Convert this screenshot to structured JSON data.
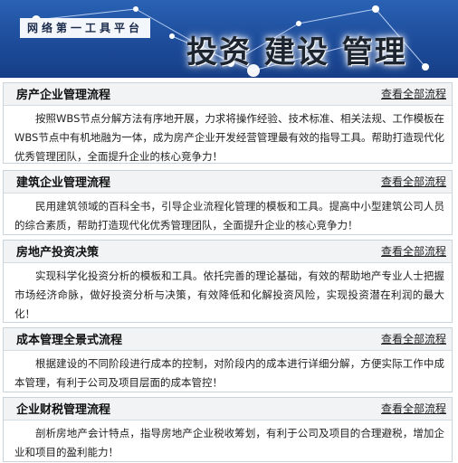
{
  "banner": {
    "tagline": "网络第一工具平台",
    "headline": "投资 建设 管理"
  },
  "sections": [
    {
      "title": "房产企业管理流程",
      "link": "查看全部流程",
      "desc": "按照WBS节点分解方法有序地开展，力求将操作经验、技术标准、相关法规、工作模板在WBS节点中有机地融为一体，成为房产企业开发经营管理最有效的指导工具。帮助打造现代化优秀管理团队，全面提升企业的核心竞争力！"
    },
    {
      "title": "建筑企业管理流程",
      "link": "查看全部流程",
      "desc": "民用建筑领域的百科全书，引导企业流程化管理的模板和工具。提高中小型建筑公司人员的综合素质，帮助打造现代化优秀管理团队，全面提升企业的核心竞争力！"
    },
    {
      "title": "房地产投资决策",
      "link": "查看全部流程",
      "desc": "实现科学化投资分析的模板和工具。依托完善的理论基础，有效的帮助地产专业人士把握市场经济命脉，做好投资分析与决策，有效降低和化解投资风险，实现投资潜在利润的最大化！"
    },
    {
      "title": "成本管理全景式流程",
      "link": "查看全部流程",
      "desc": "根据建设的不同阶段进行成本的控制，对阶段内的成本进行详细分解，方便实际工作中成本管理，有利于公司及项目层面的成本管控！"
    },
    {
      "title": "企业财税管理流程",
      "link": "查看全部流程",
      "desc": "剖析房地产会计特点，指导房地产企业税收筹划，有利于公司及项目的合理避税，增加企业和项目的盈利能力！"
    }
  ]
}
